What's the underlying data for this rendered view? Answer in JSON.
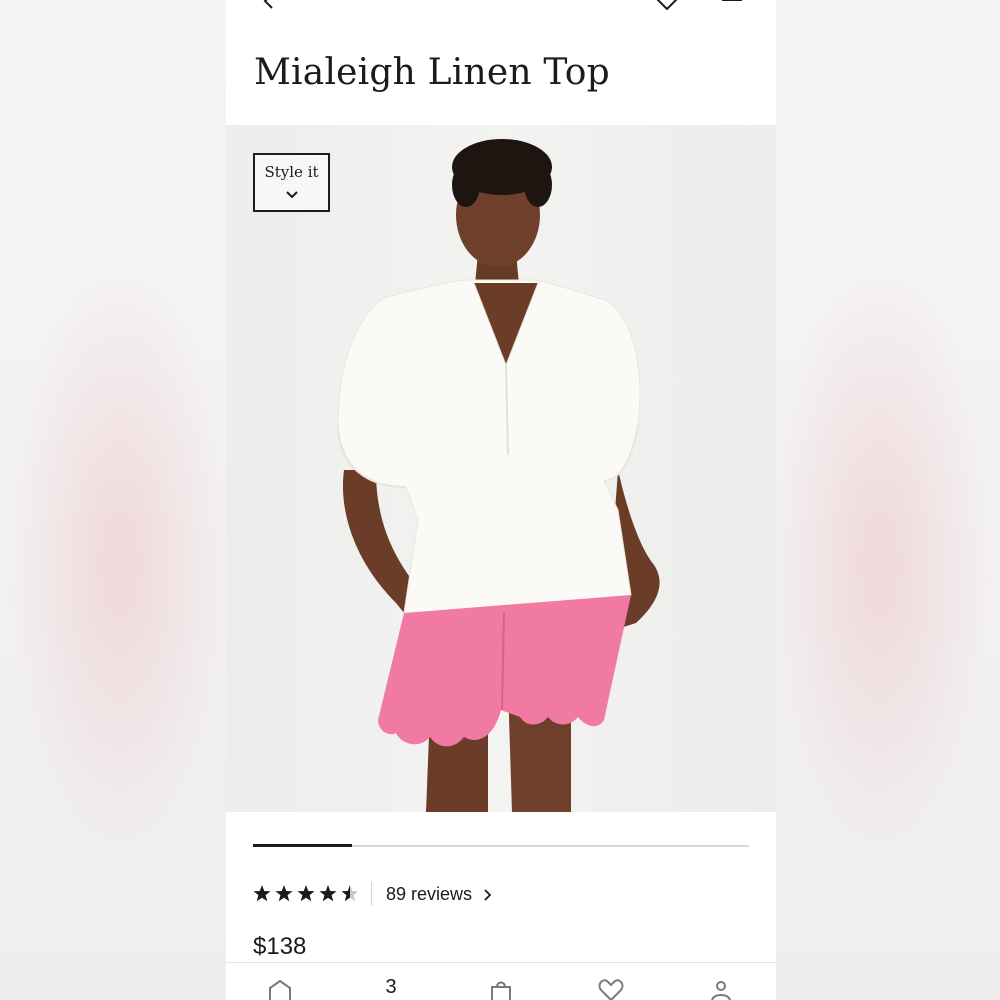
{
  "product": {
    "title": "Mialeigh Linen Top",
    "style_it_label": "Style it",
    "rating": 4.5,
    "rating_max": 5,
    "reviews_label": "89 reviews",
    "price": "$138"
  },
  "gallery": {
    "progress": 0.2
  },
  "tabbar": {
    "count_badge": "3"
  },
  "colors": {
    "shorts_pink": "#f07aa2",
    "text": "#1b1b1b"
  },
  "icons": {
    "back": "chevron-left-icon",
    "favorite": "heart-icon",
    "share": "share-icon",
    "home": "home-icon",
    "bag": "shopping-bag-icon",
    "wishlist": "heart-icon",
    "account": "person-icon"
  }
}
